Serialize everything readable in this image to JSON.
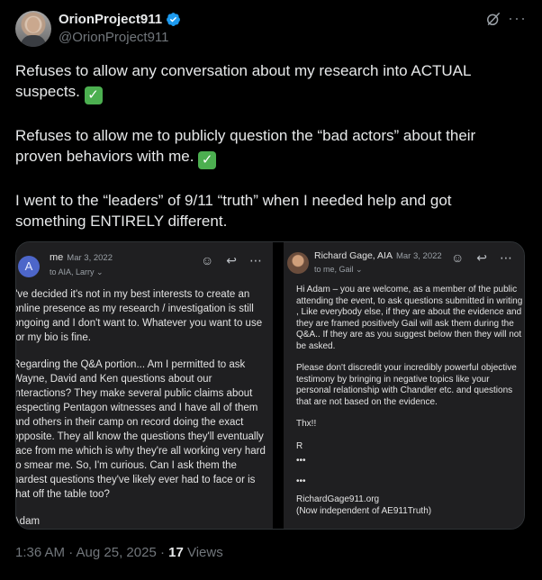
{
  "author": {
    "display_name": "OrionProject911",
    "handle": "@OrionProject911",
    "verified_icon": "verified-badge-icon",
    "verified_color": "#1d9bf0"
  },
  "header_actions": {
    "grok_icon": "grok-icon",
    "more_label": "···"
  },
  "tweet": {
    "paragraphs": [
      "Refuses to allow any conversation about my research into ACTUAL suspects.",
      "Refuses to allow me to publicly question the “bad actors” about their proven behaviors with me.",
      "I went to the “leaders” of 9/11 “truth” when I needed help and got something ENTIRELY different."
    ],
    "check_emoji": "✓"
  },
  "email_left": {
    "avatar_letter": "A",
    "from": "me",
    "date": "Mar 3, 2022",
    "to": "to AIA, Larry ⌄",
    "icons": [
      "emoji-icon",
      "reply-icon",
      "more-icon"
    ],
    "body": [
      "I've decided it's not in my best interests to create an online presence as my research / investigation is still ongoing and I don't want to. Whatever you want to use for my bio is fine.",
      "Regarding the Q&A portion... Am I permitted to ask Wayne, David and Ken questions about our interactions? They make several public claims about respecting Pentagon witnesses and I have all of them and others in their camp on record doing the exact opposite. They all know the questions they'll eventually face from me which is why they're all working very hard to smear me. So, I'm curious. Can I ask them the hardest questions they've likely ever had to face or is that off the table too?",
      "Adam",
      "..."
    ]
  },
  "email_right": {
    "from": "Richard Gage, AIA",
    "date": "Mar 3, 2022",
    "to": "to me, Gail ⌄",
    "icons": [
      "emoji-icon",
      "reply-icon",
      "more-icon"
    ],
    "body": [
      "Hi Adam – you are welcome, as a member of the public attending the event, to ask questions submitted in writing , Like everybody else, if they are about the evidence and they are framed positively Gail will ask them during the Q&A.. If they are as you suggest below then they will not be asked.",
      "Please don't discredit your incredibly powerful  objective testimony by bringing in negative topics like your personal relationship with Chandler etc. and questions that are not based on the evidence.",
      "Thx!!",
      "R",
      "•••",
      "•••",
      "RichardGage911.org",
      "(Now independent of AE911Truth)"
    ]
  },
  "meta": {
    "time": "1:36 AM · Aug 25, 2025 · ",
    "views_count": "17",
    "views_label": " Views"
  }
}
